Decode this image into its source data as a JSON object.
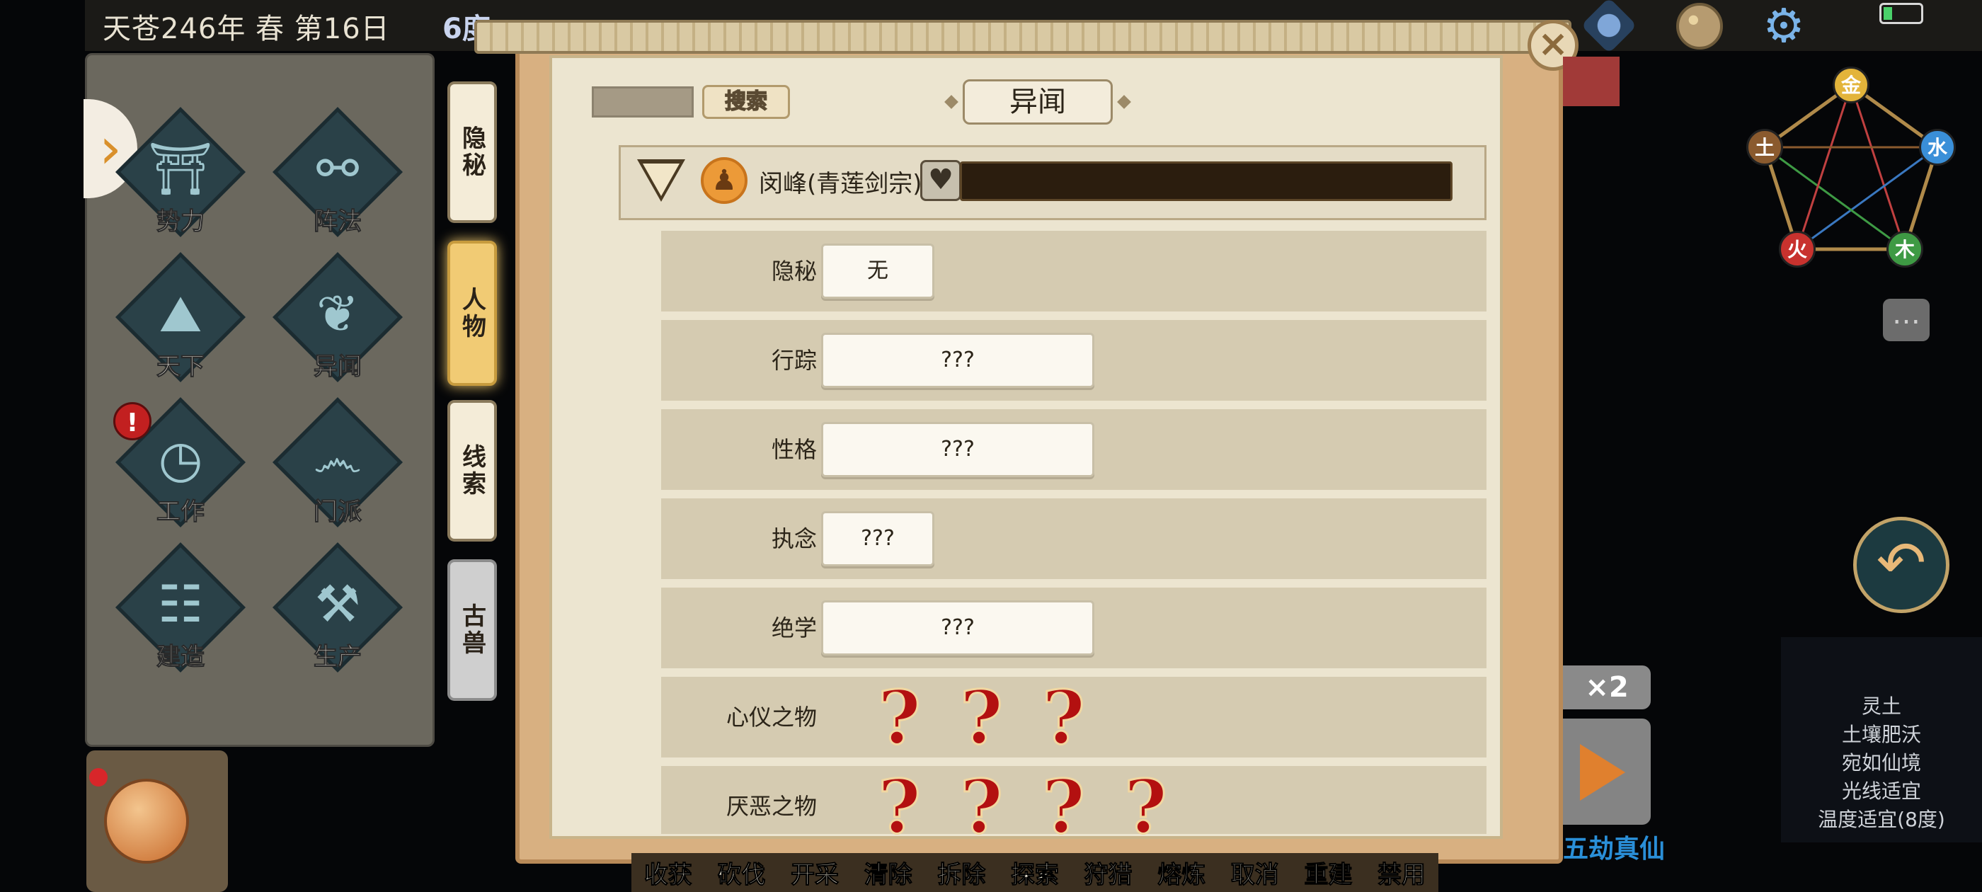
{
  "header": {
    "date": "天苍246年 春 第16日",
    "temperature": "6度",
    "icons": [
      "scroll-map-icon",
      "palette-icon",
      "gear-icon",
      "battery-icon"
    ]
  },
  "left_menu": {
    "items": [
      {
        "label": "势力",
        "icon": "faction-icon"
      },
      {
        "label": "阵法",
        "icon": "formation-icon"
      },
      {
        "label": "天下",
        "icon": "world-icon"
      },
      {
        "label": "异闻",
        "icon": "anecdote-icon"
      },
      {
        "label": "工作",
        "icon": "work-icon"
      },
      {
        "label": "门派",
        "icon": "sect-icon"
      },
      {
        "label": "建造",
        "icon": "build-icon"
      },
      {
        "label": "生产",
        "icon": "produce-icon"
      }
    ],
    "alert_mark": "!"
  },
  "side_tabs": [
    {
      "label": "隐秘"
    },
    {
      "label": "人物"
    },
    {
      "label": "线索"
    },
    {
      "label": "古兽"
    }
  ],
  "dialog": {
    "search_label": "搜索",
    "title": "异闻",
    "close_icon": "×",
    "character": {
      "name": "闵峰(青莲剑宗)"
    },
    "rows": [
      {
        "label": "隐秘",
        "value": "无"
      },
      {
        "label": "行踪",
        "value": "???"
      },
      {
        "label": "性格",
        "value": "???"
      },
      {
        "label": "执念",
        "value": "???"
      },
      {
        "label": "绝学",
        "value": "???"
      },
      {
        "label": "心仪之物",
        "marks": [
          "?",
          "?",
          "?"
        ]
      },
      {
        "label": "厌恶之物",
        "marks": [
          "?",
          "?",
          "?",
          "?"
        ]
      }
    ]
  },
  "action_bar": [
    "收获",
    "砍伐",
    "开采",
    "清除",
    "拆除",
    "探索",
    "狩猎",
    "熔炼",
    "取消",
    "重建",
    "禁用"
  ],
  "five_elements": [
    {
      "label": "金",
      "color": "#e3b43a"
    },
    {
      "label": "水",
      "color": "#3a8fd8"
    },
    {
      "label": "木",
      "color": "#3e9a44"
    },
    {
      "label": "火",
      "color": "#c8322e"
    },
    {
      "label": "土",
      "color": "#8a5a2e"
    }
  ],
  "speed_label": "×2",
  "tribulation_text": "五劫真仙",
  "tile_info": [
    "灵土",
    "土壤肥沃",
    "宛如仙境",
    "光线适宜",
    "温度适宜(8度)"
  ]
}
